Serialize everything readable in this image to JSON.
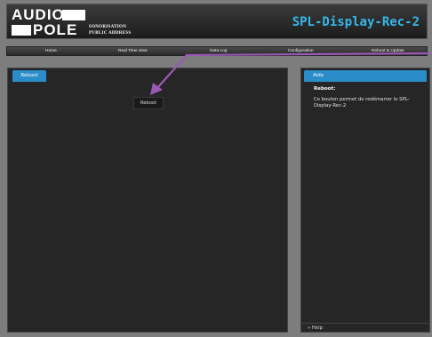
{
  "header": {
    "logo_line1": "AUDIO",
    "logo_line2": "POLE",
    "tagline_line1": "SONORISATION",
    "tagline_line2": "PUBLIC ADDRESS",
    "device_name": "SPL-Display-Rec-2"
  },
  "nav": {
    "items": [
      "Home",
      "Real Time view",
      "Data Log",
      "Configuration",
      "Reboot & Update"
    ]
  },
  "main": {
    "tab_label": "Reboot",
    "reboot_button_label": "Reboot"
  },
  "help": {
    "tab_label": "Aide",
    "heading": "Reboot:",
    "text": "Ce bouton permet de redémarrer le SPL-Display-Rec-2",
    "footer": "» Help"
  },
  "colors": {
    "accent": "#2a8dc9",
    "device_name": "#36b7e8",
    "annotation_arrow": "#9b59b6"
  }
}
